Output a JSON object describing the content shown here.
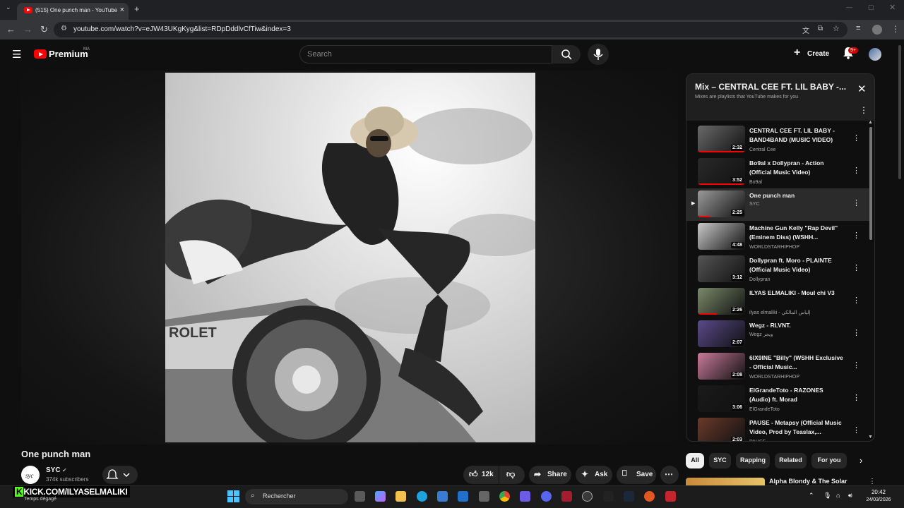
{
  "browser": {
    "tab_title": "(515) One punch man - YouTube",
    "url": "youtube.com/watch?v=eJW43UKgKyg&list=RDpDddlvCfTiw&index=3"
  },
  "header": {
    "brand": "Premium",
    "brand_tag": "MA",
    "search_placeholder": "Search",
    "create_label": "Create",
    "notif_badge": "9+"
  },
  "video": {
    "title": "One punch man",
    "channel": "SYC",
    "subscribers": "374k subscribers",
    "likes": "12k",
    "share_label": "Share",
    "ask_label": "Ask",
    "save_label": "Save"
  },
  "playlist": {
    "title": "Mix – CENTRAL CEE FT. LIL BABY -...",
    "subtitle": "Mixes are playlists that YouTube makes for you",
    "items": [
      {
        "title": "CENTRAL CEE FT. LIL BABY - BAND4BAND (MUSIC VIDEO)",
        "channel": "Central Cee",
        "duration": "2:32",
        "thumb_color": "#6a6a6a",
        "progress": 1.0
      },
      {
        "title": "Bo9al x Dollypran - Action (Official Music Video)",
        "channel": "Bo9al",
        "duration": "3:52",
        "thumb_color": "#2a2a2a",
        "progress": 1.0
      },
      {
        "title": "One punch man",
        "channel": "SYC",
        "duration": "2:25",
        "thumb_color": "#9a9a9a",
        "progress": 0.25
      },
      {
        "title": "Machine Gun Kelly \"Rap Devil\" (Eminem Diss) (WSHH...",
        "channel": "WORLDSTARHIPHOP",
        "duration": "4:48",
        "thumb_color": "#c9c9c9",
        "progress": 0
      },
      {
        "title": "Dollypran ft. Moro - PLAINTE (Official Music Video)",
        "channel": "Dollypran",
        "duration": "3:12",
        "thumb_color": "#555555",
        "progress": 0
      },
      {
        "title": "ILYAS ELMALIKI - Moul chi V3",
        "channel": "ilyas elmaliki - إلياس المالكي",
        "duration": "2:26",
        "thumb_color": "#7a8a6a",
        "progress": 0.4
      },
      {
        "title": "Wegz - RLVNT.",
        "channel": "Wegz ويجز",
        "duration": "2:07",
        "thumb_color": "#5a4a8a",
        "progress": 0
      },
      {
        "title": "6IX9INE \"Billy\" (WSHH Exclusive - Official Music...",
        "channel": "WORLDSTARHIPHOP",
        "duration": "2:08",
        "thumb_color": "#c87a9a",
        "progress": 0
      },
      {
        "title": "ElGrandeToto - RAZONES (Audio) ft. Morad",
        "channel": "ElGrandeToto",
        "duration": "3:06",
        "thumb_color": "#1a1a1a",
        "progress": 0
      },
      {
        "title": "PAUSE - Metapsy (Official Music Video, Prod by Teaslax,...",
        "channel": "PAUSE",
        "duration": "2:03",
        "thumb_color": "#6a3a2a",
        "progress": 0
      }
    ]
  },
  "chips": [
    "All",
    "SYC",
    "Rapping",
    "Related",
    "For you"
  ],
  "next_video_title": "Alpha Blondy & The Solar",
  "taskbar": {
    "overlay_text": "KICK.COM/ILYASELMALIKI",
    "weather": "Temps dégagé",
    "search_label": "Rechercher",
    "time": "20:42",
    "date": "24/03/2026"
  }
}
